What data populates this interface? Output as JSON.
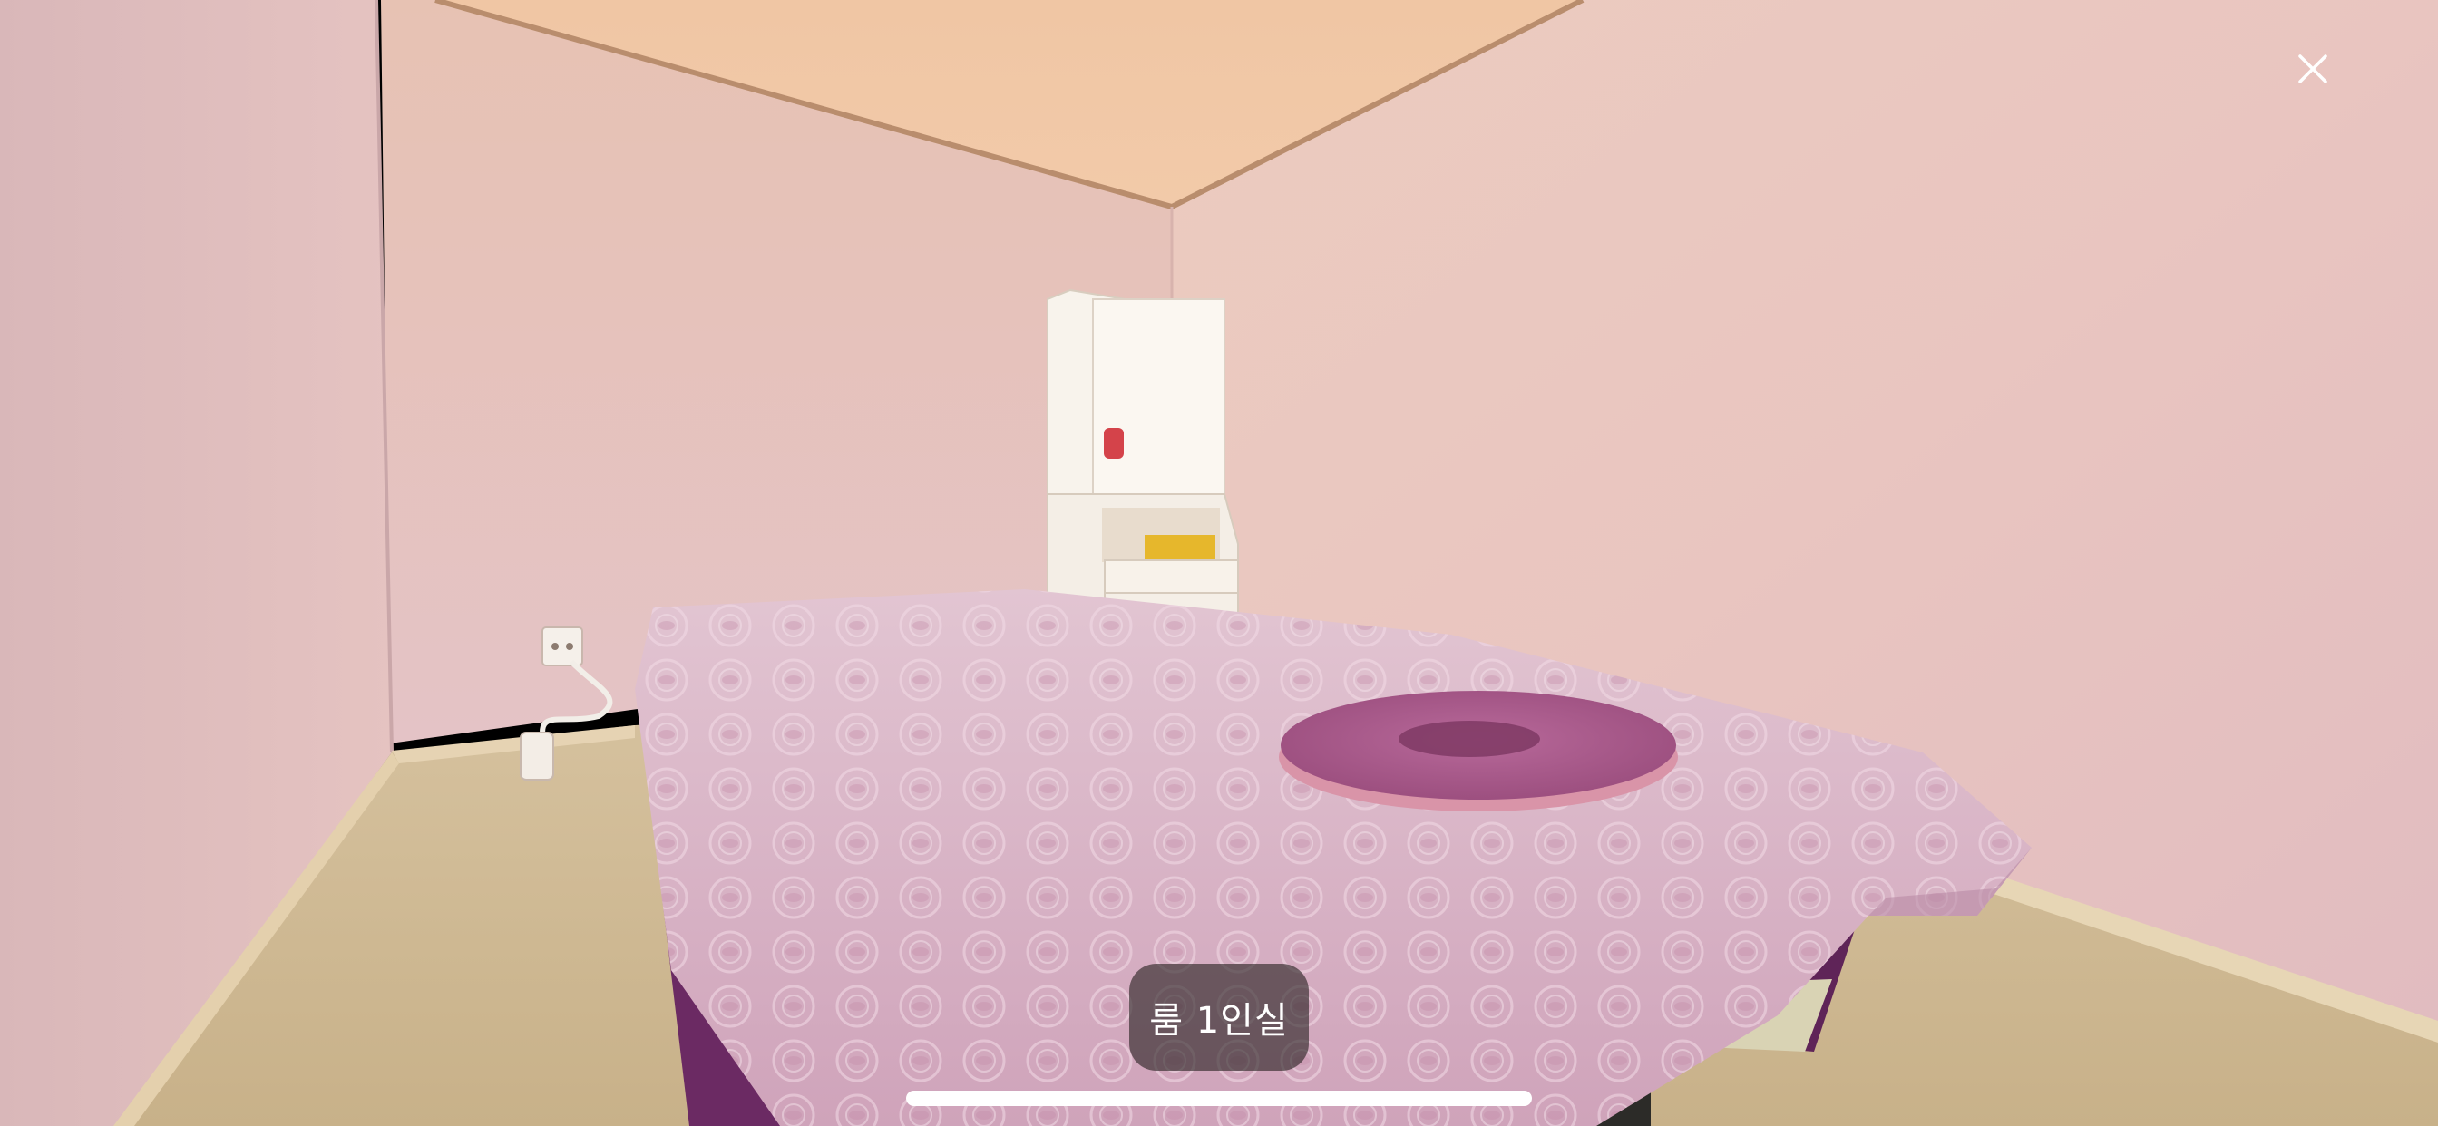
{
  "viewer": {
    "caption": "룸 1인실",
    "close_icon": "close-icon"
  },
  "colors": {
    "wall": "#EAC9C3",
    "ceiling": "#EFC6A8",
    "floor": "#CDB894",
    "bedspread": "#D9B3C4",
    "bed_skirt": "#6B2A63",
    "cushion": "#A2547F",
    "cabinet": "#F7F1EA",
    "caption_bg": "#2A2222"
  }
}
